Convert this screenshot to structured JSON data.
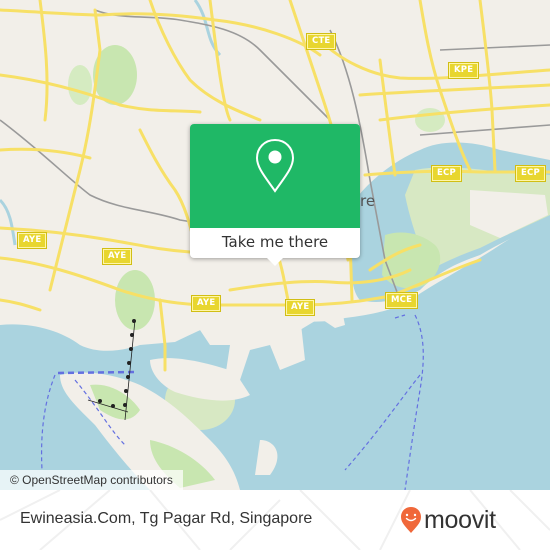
{
  "map": {
    "colors": {
      "land": "#f2efe9",
      "water": "#aad3df",
      "park": "#c8e6b0",
      "road": "#f7e066",
      "rail": "#9a9a9a",
      "ferry": "#6470e0"
    },
    "road_shields": [
      "CTE",
      "KPE",
      "ECP",
      "ECP",
      "AYE",
      "AYE",
      "AYE",
      "AYE",
      "MCE"
    ],
    "area_label_fragment": "re",
    "attribution": "© OpenStreetMap contributors"
  },
  "popup": {
    "icon": "map-pin-icon",
    "accent": "#1fb866",
    "cta_label": "Take me there"
  },
  "footer": {
    "place_name": "Ewineasia.Com, Tg Pagar Rd, Singapore",
    "brand": {
      "icon": "moovit-pin-smile-icon",
      "wordmark": "moovit",
      "pin_color": "#f0683a"
    }
  }
}
